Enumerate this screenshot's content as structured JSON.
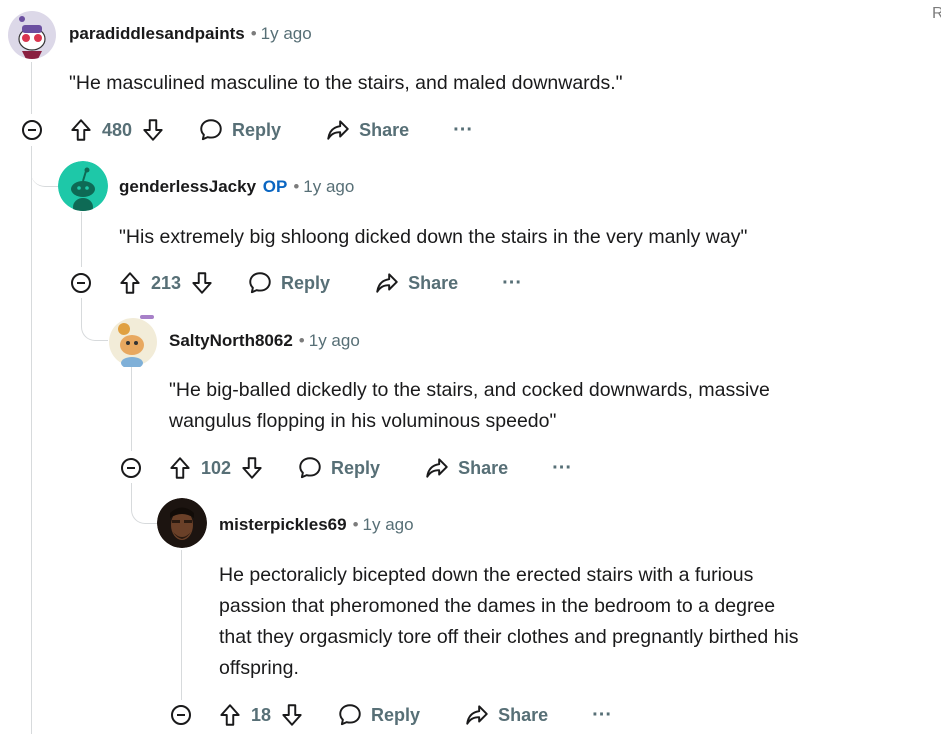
{
  "colors": {
    "text": "#1a1a1b",
    "meta": "#576f76",
    "op": "#0a66c2",
    "line": "#d7dadc"
  },
  "corner_text": "R",
  "comments": [
    {
      "author": "paradiddlesandpaints",
      "op_badge": "",
      "time": "1y ago",
      "lines": [
        "\"He masculined masculine to the stairs, and maled downwards.\""
      ],
      "votes": "480",
      "reply": "Reply",
      "share": "Share",
      "more": "···"
    },
    {
      "author": "genderlessJacky",
      "op_badge": "OP",
      "time": "1y ago",
      "lines": [
        "\"His extremely big shloong dicked down the stairs in the very manly way\""
      ],
      "votes": "213",
      "reply": "Reply",
      "share": "Share",
      "more": "···"
    },
    {
      "author": "SaltyNorth8062",
      "op_badge": "",
      "time": "1y ago",
      "lines": [
        "\"He big-balled dickedly to the stairs, and cocked downwards, massive",
        "wangulus flopping in his voluminous speedo\""
      ],
      "votes": "102",
      "reply": "Reply",
      "share": "Share",
      "more": "···"
    },
    {
      "author": "misterpickles69",
      "op_badge": "",
      "time": "1y ago",
      "lines": [
        "He pectoralicly bicepted down the erected stairs with a furious",
        "passion that pheromoned the dames in the bedroom to a degree",
        "that they orgasmicly tore off their clothes and pregnantly birthed his",
        "offspring."
      ],
      "votes": "18",
      "reply": "Reply",
      "share": "Share",
      "more": "···"
    }
  ]
}
